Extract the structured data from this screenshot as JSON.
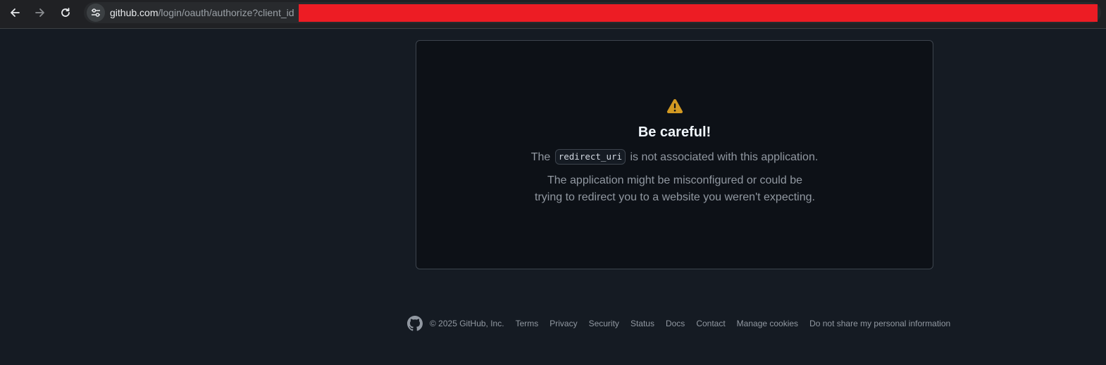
{
  "browser": {
    "url_host": "github.com",
    "url_path": "/login/oauth/authorize?client_id"
  },
  "alert": {
    "title": "Be careful!",
    "line1_prefix": "The",
    "code": "redirect_uri",
    "line1_suffix": "is not associated with this application.",
    "line2": "The application might be misconfigured or could be",
    "line3": "trying to redirect you to a website you weren't expecting."
  },
  "footer": {
    "copyright": "© 2025 GitHub, Inc.",
    "links": [
      "Terms",
      "Privacy",
      "Security",
      "Status",
      "Docs",
      "Contact",
      "Manage cookies",
      "Do not share my personal information"
    ]
  },
  "colors": {
    "page_bg": "#151b23",
    "card_bg": "#0d1117",
    "warning": "#d29922",
    "redaction": "#ed1c24"
  },
  "icons": [
    "back-arrow-icon",
    "forward-arrow-icon",
    "reload-icon",
    "site-settings-icon",
    "alert-triangle-icon",
    "github-mark-icon"
  ]
}
